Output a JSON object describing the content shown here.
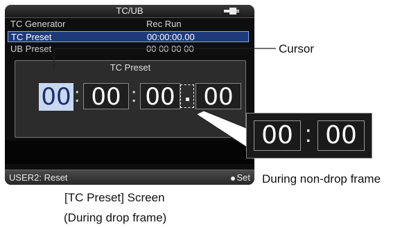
{
  "screen": {
    "title": "TC/UB",
    "battery_icon": "battery-plug-icon",
    "rows": [
      {
        "label": "TC Generator",
        "value": "Rec Run"
      },
      {
        "label": "TC Preset",
        "value": "00:00:00.00"
      },
      {
        "label": "UB Preset",
        "value": "00 00 00 00"
      }
    ],
    "dialog": {
      "title": "TC Preset",
      "digits": [
        "00",
        "00",
        "00",
        "00"
      ],
      "colon": ":"
    },
    "status": {
      "left": "USER2: Reset",
      "right": "Set"
    }
  },
  "zoom": {
    "digits": [
      "00",
      "00"
    ],
    "colon": ":"
  },
  "annotations": {
    "cursor": "Cursor",
    "screen_caption_line1": "[TC Preset] Screen",
    "screen_caption_line2": "(During drop frame)",
    "zoom_caption": "During non-drop frame"
  },
  "colors": {
    "selected_row": "#1e3a7a",
    "cursor_highlight": "#c8d8f0"
  }
}
